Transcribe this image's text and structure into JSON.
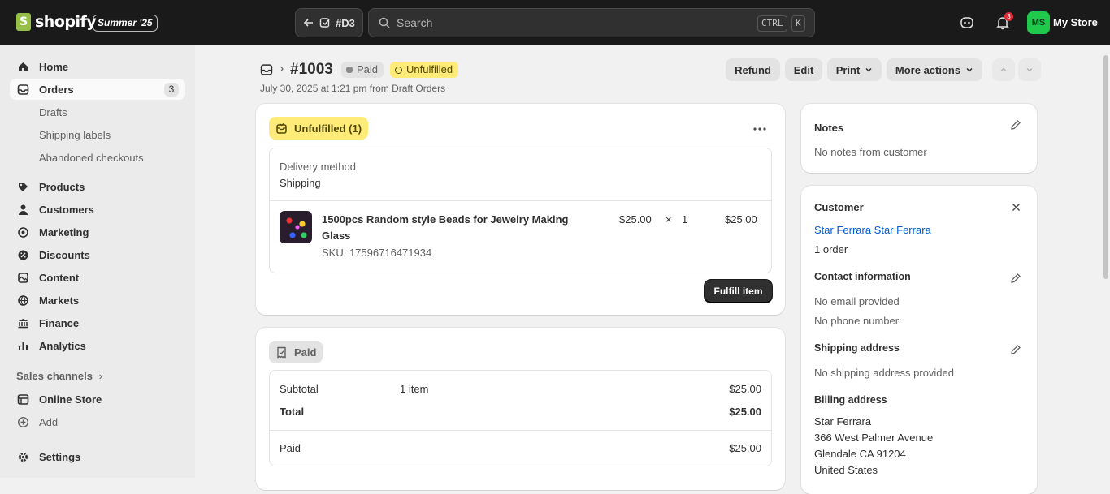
{
  "topbar": {
    "brand": "shopify",
    "edition_badge": "Summer '25",
    "back_button_label": "#D3",
    "search_placeholder": "Search",
    "shortcut_keys": [
      "CTRL",
      "K"
    ],
    "notification_count": "3",
    "avatar_initials": "MS",
    "store_name": "My Store"
  },
  "sidebar": {
    "items": [
      {
        "label": "Home",
        "icon": "home-icon"
      },
      {
        "label": "Orders",
        "icon": "orders-icon",
        "count": "3"
      },
      {
        "label": "Drafts"
      },
      {
        "label": "Shipping labels"
      },
      {
        "label": "Abandoned checkouts"
      },
      {
        "label": "Products",
        "icon": "tag-icon"
      },
      {
        "label": "Customers",
        "icon": "person-icon"
      },
      {
        "label": "Marketing",
        "icon": "target-icon"
      },
      {
        "label": "Discounts",
        "icon": "discount-icon"
      },
      {
        "label": "Content",
        "icon": "content-icon"
      },
      {
        "label": "Markets",
        "icon": "globe-icon"
      },
      {
        "label": "Finance",
        "icon": "bank-icon"
      },
      {
        "label": "Analytics",
        "icon": "chart-icon"
      }
    ],
    "sales_channels_label": "Sales channels",
    "online_store_label": "Online Store",
    "add_label": "Add",
    "settings_label": "Settings"
  },
  "header": {
    "order_number": "#1003",
    "payment_status": "Paid",
    "fulfillment_status": "Unfulfilled",
    "subtitle": "July 30, 2025 at 1:21 pm from Draft Orders",
    "buttons": {
      "refund": "Refund",
      "edit": "Edit",
      "print": "Print",
      "more": "More actions"
    }
  },
  "fulfillment_card": {
    "badge": "Unfulfilled (1)",
    "delivery_method_label": "Delivery method",
    "delivery_method_value": "Shipping",
    "item": {
      "title_line1": "1500pcs Random style Beads for Jewelry Making",
      "title_line2": "Glass",
      "sku": "SKU: 17596716471934",
      "unit_price": "$25.00",
      "times": "×",
      "quantity": "1",
      "total": "$25.00"
    },
    "fulfill_button": "Fulfill item"
  },
  "payment_card": {
    "badge": "Paid",
    "subtotal_label": "Subtotal",
    "subtotal_items": "1 item",
    "subtotal_value": "$25.00",
    "total_label": "Total",
    "total_value": "$25.00",
    "paid_label": "Paid",
    "paid_value": "$25.00"
  },
  "notes_card": {
    "title": "Notes",
    "text": "No notes from customer"
  },
  "customer_card": {
    "title": "Customer",
    "name": "Star Ferrara Star Ferrara",
    "orders": "1 order",
    "contact_title": "Contact information",
    "email": "No email provided",
    "phone": "No phone number",
    "shipping_title": "Shipping address",
    "shipping_text": "No shipping address provided",
    "billing_title": "Billing address",
    "billing_lines": [
      "Star Ferrara",
      "366 West Palmer Avenue",
      "Glendale CA 91204",
      "United States"
    ]
  },
  "colors": {
    "topbar_bg": "#1a1a1a",
    "unfulfilled_badge": "#ffeb78",
    "link": "#005bd3",
    "primary_button": "#303030"
  }
}
